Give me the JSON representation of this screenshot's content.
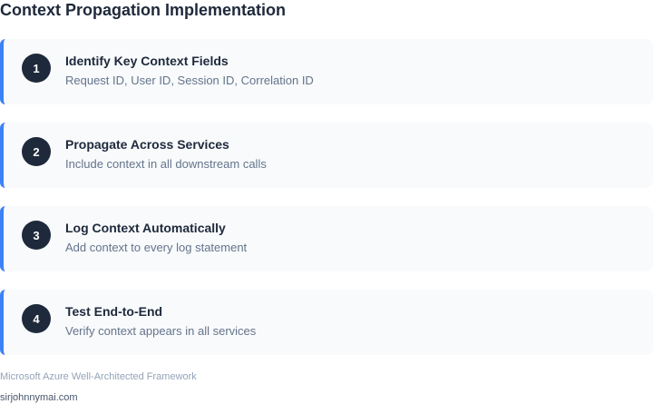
{
  "page": {
    "title": "Context Propagation Implementation"
  },
  "steps": [
    {
      "number": "1",
      "title": "Identify Key Context Fields",
      "description": "Request ID, User ID, Session ID, Correlation ID"
    },
    {
      "number": "2",
      "title": "Propagate Across Services",
      "description": "Include context in all downstream calls"
    },
    {
      "number": "3",
      "title": "Log Context Automatically",
      "description": "Add context to every log statement"
    },
    {
      "number": "4",
      "title": "Test End-to-End",
      "description": "Verify context appears in all services"
    }
  ],
  "footer": {
    "source": "Microsoft Azure Well-Architected Framework",
    "author": "sirjohnnymai.com"
  },
  "colors": {
    "accent": "#3b82f6",
    "badge": "#1e293b",
    "card_background": "#f8fafc"
  }
}
